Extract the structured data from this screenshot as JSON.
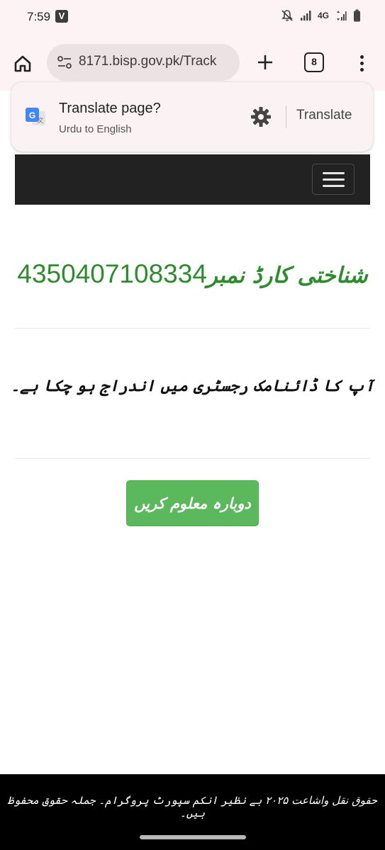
{
  "status_bar": {
    "time": "7:59",
    "app_badge": "V",
    "network": "4G",
    "icons": [
      "mute-icon",
      "signal-icon",
      "data-signal-icon",
      "battery-icon"
    ]
  },
  "browser": {
    "url": "8171.bisp.gov.pk/Track",
    "tab_count": "8",
    "icons": [
      "home-icon",
      "tune-icon",
      "plus-icon",
      "tabs-icon",
      "more-vert-icon"
    ]
  },
  "translate": {
    "title": "Translate page?",
    "subtitle": "Urdu to English",
    "button": "Translate",
    "icons": [
      "google-translate-icon",
      "gear-icon"
    ]
  },
  "site_nav": {
    "icons": [
      "hamburger-icon"
    ]
  },
  "content": {
    "cnic_label": "شناختی کارڈ نمبر",
    "cnic_number": "4350407108334",
    "message": "آپ کا ڈائنامک رجسٹری میں اندراج ہو چکا ہے۔",
    "retry_button": "دوبارہ معلوم کریں"
  },
  "footer": {
    "text": "حقوق نقل واشاعت ۲۰۲۵ بے نظیر انکم سپورٹ پروگرام۔ جملہ حقوق محفوظ ہیں۔"
  },
  "colors": {
    "accent_green": "#2e8b2e",
    "button_green": "#5cb85c",
    "nav_dark": "#222222",
    "footer_bg": "#000000",
    "chrome_bg": "#fdf3f4"
  }
}
